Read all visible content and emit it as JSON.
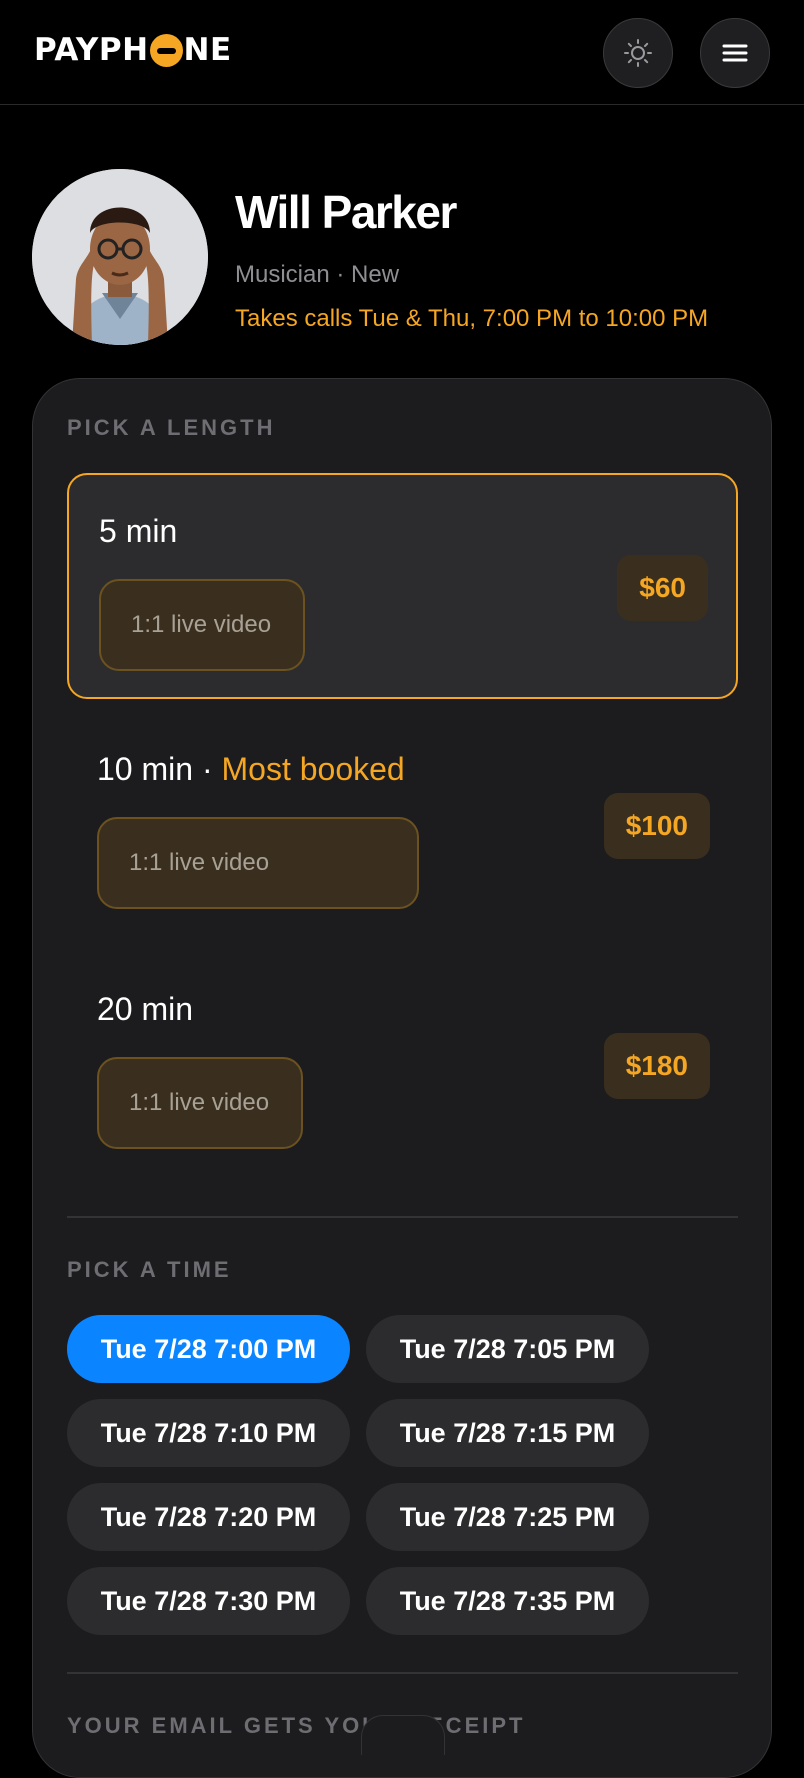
{
  "header": {
    "logo_text_left": "PAYPH",
    "logo_text_right": "NE",
    "theme_icon": "sun-icon",
    "menu_icon": "hamburger-menu-icon"
  },
  "profile": {
    "name": "Will Parker",
    "subtitle": "Musician · New",
    "hours": "Takes calls Tue & Thu, 7:00 PM to 10:00 PM"
  },
  "length_section": {
    "label": "PICK A LENGTH",
    "options": [
      {
        "title": "5 min",
        "badge": "",
        "type": "1:1 live video",
        "price": "$60",
        "selected": true
      },
      {
        "title": "10 min",
        "badge": "Most booked",
        "type": "1:1 live video",
        "price": "$100",
        "selected": false
      },
      {
        "title": "20 min",
        "badge": "",
        "type": "1:1 live video",
        "price": "$180",
        "selected": false
      }
    ]
  },
  "time_section": {
    "label": "PICK A TIME",
    "slots": [
      "Tue 7/28 7:00 PM",
      "Tue 7/28 7:05 PM",
      "Tue 7/28 7:10 PM",
      "Tue 7/28 7:15 PM",
      "Tue 7/28 7:20 PM",
      "Tue 7/28 7:25 PM",
      "Tue 7/28 7:30 PM",
      "Tue 7/28 7:35 PM"
    ],
    "selected_index": 0
  },
  "email_section": {
    "label": "YOUR EMAIL GETS YOUR RECEIPT"
  },
  "colors": {
    "accent": "#f5a623",
    "selected_slot": "#0a84ff",
    "background": "#000000",
    "card": "#1c1c1e"
  }
}
